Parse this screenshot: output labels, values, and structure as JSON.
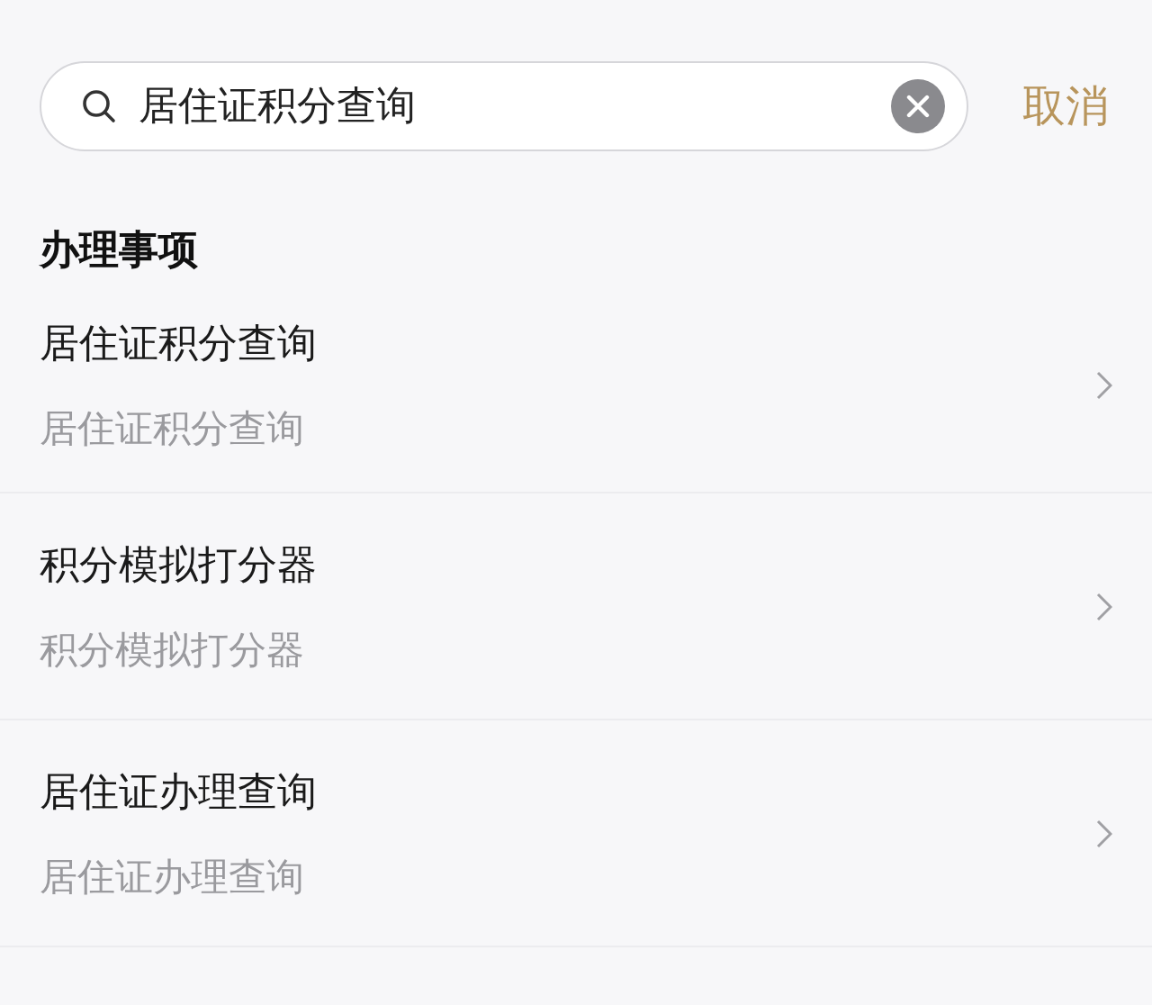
{
  "search": {
    "value": "居住证积分查询"
  },
  "cancel": "取消",
  "section": {
    "title": "办理事项",
    "items": [
      {
        "title": "居住证积分查询",
        "subtitle": "居住证积分查询"
      },
      {
        "title": "积分模拟打分器",
        "subtitle": "积分模拟打分器"
      },
      {
        "title": "居住证办理查询",
        "subtitle": "居住证办理查询"
      }
    ]
  }
}
